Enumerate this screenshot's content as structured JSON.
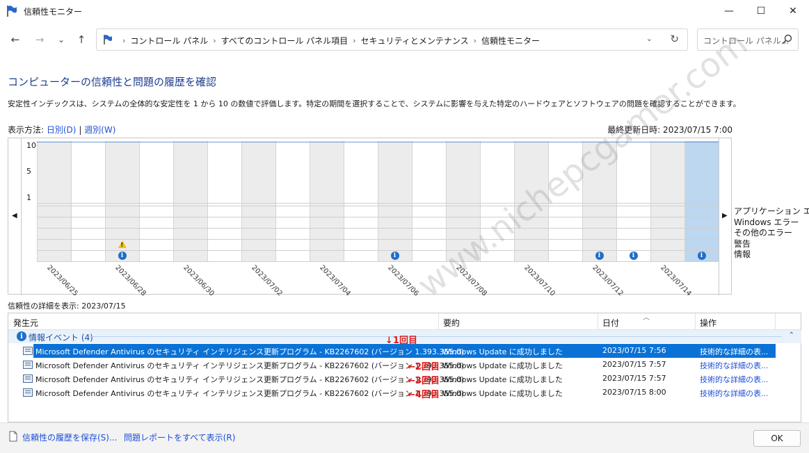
{
  "window": {
    "title": "信頼性モニター",
    "minimize": "—",
    "maximize": "☐",
    "close": "✕"
  },
  "nav": {
    "back": "←",
    "forward": "→",
    "recent": "⌄",
    "up": "↑",
    "breadcrumbs": [
      "コントロール パネル",
      "すべてのコントロール パネル項目",
      "セキュリティとメンテナンス",
      "信頼性モニター"
    ],
    "separator": "›",
    "dropdown": "⌄",
    "refresh": "↻",
    "search_placeholder": "コントロール パネル..."
  },
  "page": {
    "heading": "コンピューターの信頼性と問題の履歴を確認",
    "description": "安定性インデックスは、システムの全体的な安定性を 1 から 10 の数値で評価します。特定の期間を選択することで、システムに影響を与えた特定のハードウェアとソフトウェアの問題を確認することができます。",
    "view_label": "表示方法:",
    "view_daily": "日別(D)",
    "view_sep": "|",
    "view_weekly": "週別(W)",
    "last_updated": "最終更新日時: 2023/07/15 7:00"
  },
  "chart_data": {
    "type": "table",
    "y_ticks": [
      "10",
      "5",
      "1"
    ],
    "x_labels": [
      "2023/06/25",
      "2023/06/28",
      "2023/06/30",
      "2023/07/02",
      "2023/07/04",
      "2023/07/06",
      "2023/07/08",
      "2023/07/10",
      "2023/07/12",
      "2023/07/14"
    ],
    "rows": [
      "アプリケーション エラー",
      "Windows エラー",
      "その他のエラー",
      "警告",
      "情報"
    ],
    "selected_date": "2023/07/15"
  },
  "details": {
    "label": "信頼性の詳細を表示: 2023/07/15",
    "columns": [
      "発生元",
      "要約",
      "日付",
      "操作"
    ],
    "group": {
      "label": "情報イベント (4)",
      "chevron": "⌃"
    },
    "rows": [
      {
        "source": "Microsoft Defender Antivirus のセキュリティ インテリジェンス更新プログラム - KB2267602 (バージョン 1.393.355.0)",
        "summary": "Windows Update に成功しました",
        "date": "2023/07/15 7:56",
        "action": "技術的な詳細の表..."
      },
      {
        "source": "Microsoft Defender Antivirus のセキュリティ インテリジェンス更新プログラム - KB2267602 (バージョン 1.393.355.0)",
        "summary": "Windows Update に成功しました",
        "date": "2023/07/15 7:57",
        "action": "技術的な詳細の表..."
      },
      {
        "source": "Microsoft Defender Antivirus のセキュリティ インテリジェンス更新プログラム - KB2267602 (バージョン 1.393.355.0)",
        "summary": "Windows Update に成功しました",
        "date": "2023/07/15 7:57",
        "action": "技術的な詳細の表..."
      },
      {
        "source": "Microsoft Defender Antivirus のセキュリティ インテリジェンス更新プログラム - KB2267602 (バージョン 1.393.355.0)",
        "summary": "Windows Update に成功しました",
        "date": "2023/07/15 8:00",
        "action": "技術的な詳細の表..."
      }
    ],
    "annotations": [
      "↓1回目",
      "←2回目",
      "←3回目",
      "←4回目"
    ]
  },
  "footer": {
    "save": "信頼性の履歴を保存(S)...",
    "reports": "問題レポートをすべて表示(R)",
    "ok": "OK"
  },
  "watermark": "www.nichepcgamer.com",
  "colors": {
    "accent": "#0a72d6",
    "info": "#1e6fc9",
    "warning": "#f2c200",
    "selected_column": "#bcd7ef",
    "annotation": "#e01a1a"
  }
}
